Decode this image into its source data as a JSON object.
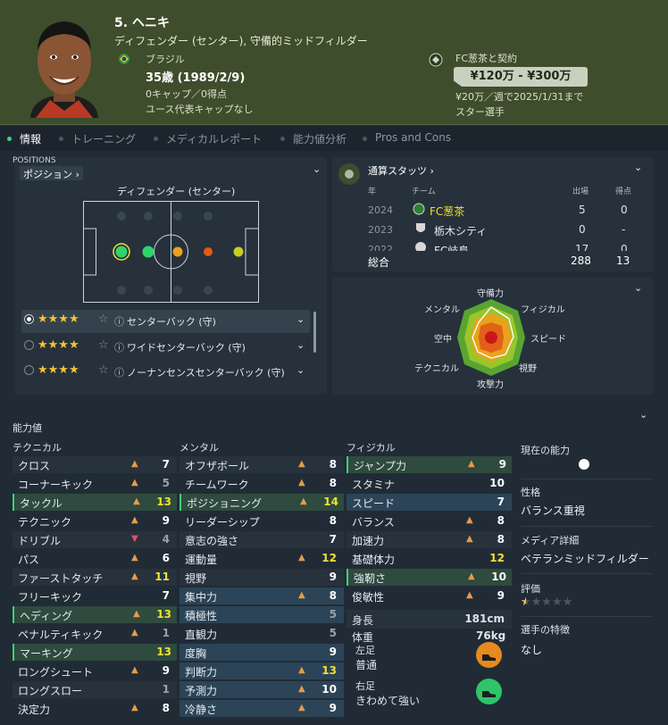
{
  "player": {
    "name": "5. ヘニキ",
    "position_desc": "ディフェンダー (センター), 守備的ミッドフィルダー",
    "nationality": "ブラジル",
    "age": "35歳 (1989/2/9)",
    "caps": "0キャップ／0得点",
    "youth_caps": "ユース代表キャップなし",
    "contract_club": "FC葱茶と契約",
    "value": "¥120万 - ¥300万",
    "wage": "¥20万／週で2025/1/31まで",
    "status": "スター選手"
  },
  "tabs": [
    {
      "label": "情報"
    },
    {
      "label": "トレーニング"
    },
    {
      "label": "メディカルレポート"
    },
    {
      "label": "能力値分析"
    },
    {
      "label": "Pros and Cons"
    }
  ],
  "positions": {
    "header": "ポジション",
    "overlay": "POSITIONS",
    "pitch_title": "ディフェンダー (センター)",
    "roles": [
      {
        "name": "センターバック (守)",
        "stars": "★★★★",
        "half_star": "☆"
      },
      {
        "name": "ワイドセンターバック (守)",
        "stars": "★★★★",
        "half_star": "☆"
      },
      {
        "name": "ノーナンセンスセンターバック (守)",
        "stars": "★★★★",
        "half_star": "☆"
      }
    ]
  },
  "career": {
    "header": "通算スタッツ",
    "col_year": "年",
    "col_team": "チーム",
    "col_apps": "出場",
    "col_goals": "得点",
    "rows": [
      {
        "year": "2024",
        "team": "FC葱茶",
        "apps": "5",
        "goals": "0"
      },
      {
        "year": "2023",
        "team": "栃木シティ",
        "apps": "0",
        "goals": "-"
      },
      {
        "year": "2022",
        "team": "FC岐阜",
        "apps": "17",
        "goals": "0"
      }
    ],
    "total_label": "総合",
    "total_apps": "288",
    "total_goals": "13"
  },
  "radar": {
    "labels": {
      "top": "守備力",
      "top_right": "フィジカル",
      "right": "スピード",
      "bottom_right": "視野",
      "bottom": "攻撃力",
      "bottom_left": "テクニカル",
      "left": "空中",
      "top_left": "メンタル"
    }
  },
  "attributes": {
    "section_label": "能力値",
    "technical_header": "テクニカル",
    "mental_header": "メンタル",
    "physical_header": "フィジカル",
    "technical": [
      {
        "name": "クロス",
        "value": "7",
        "arrow": "▲"
      },
      {
        "name": "コーナーキック",
        "value": "5",
        "arrow": "▲"
      },
      {
        "name": "タックル",
        "value": "13",
        "arrow": "▲"
      },
      {
        "name": "テクニック",
        "value": "9",
        "arrow": "▲"
      },
      {
        "name": "ドリブル",
        "value": "4",
        "arrow": "▼"
      },
      {
        "name": "パス",
        "value": "6",
        "arrow": "▲"
      },
      {
        "name": "ファーストタッチ",
        "value": "11",
        "arrow": "▲"
      },
      {
        "name": "フリーキック",
        "value": "7",
        "arrow": ""
      },
      {
        "name": "ヘディング",
        "value": "13",
        "arrow": "▲"
      },
      {
        "name": "ペナルティキック",
        "value": "1",
        "arrow": "▲"
      },
      {
        "name": "マーキング",
        "value": "13",
        "arrow": ""
      },
      {
        "name": "ロングシュート",
        "value": "9",
        "arrow": "▲"
      },
      {
        "name": "ロングスロー",
        "value": "1",
        "arrow": ""
      },
      {
        "name": "決定力",
        "value": "8",
        "arrow": "▲"
      }
    ],
    "mental": [
      {
        "name": "オフザボール",
        "value": "8",
        "arrow": "▲"
      },
      {
        "name": "チームワーク",
        "value": "8",
        "arrow": "▲"
      },
      {
        "name": "ポジショニング",
        "value": "14",
        "arrow": "▲"
      },
      {
        "name": "リーダーシップ",
        "value": "8",
        "arrow": ""
      },
      {
        "name": "意志の強さ",
        "value": "7",
        "arrow": ""
      },
      {
        "name": "運動量",
        "value": "12",
        "arrow": "▲"
      },
      {
        "name": "視野",
        "value": "9",
        "arrow": ""
      },
      {
        "name": "集中力",
        "value": "8",
        "arrow": "▲"
      },
      {
        "name": "積極性",
        "value": "5",
        "arrow": ""
      },
      {
        "name": "直観力",
        "value": "5",
        "arrow": ""
      },
      {
        "name": "度胸",
        "value": "9",
        "arrow": ""
      },
      {
        "name": "判断力",
        "value": "13",
        "arrow": "▲"
      },
      {
        "name": "予測力",
        "value": "10",
        "arrow": "▲"
      },
      {
        "name": "冷静さ",
        "value": "9",
        "arrow": "▲"
      }
    ],
    "physical": [
      {
        "name": "ジャンプ力",
        "value": "9",
        "arrow": "▲"
      },
      {
        "name": "スタミナ",
        "value": "10",
        "arrow": ""
      },
      {
        "name": "スピード",
        "value": "7",
        "arrow": ""
      },
      {
        "name": "バランス",
        "value": "8",
        "arrow": "▲"
      },
      {
        "name": "加速力",
        "value": "8",
        "arrow": "▲"
      },
      {
        "name": "基礎体力",
        "value": "12",
        "arrow": ""
      },
      {
        "name": "強靭さ",
        "value": "10",
        "arrow": "▲"
      },
      {
        "name": "俊敏性",
        "value": "9",
        "arrow": "▲"
      }
    ],
    "height_label": "身長",
    "height_value": "181cm",
    "weight_label": "体重",
    "weight_value": "76kg",
    "left_foot_label": "左足",
    "left_foot_value": "普通",
    "right_foot_label": "右足",
    "right_foot_value": "きわめて強い"
  },
  "side": {
    "current_ability_label": "現在の能力",
    "personality_label": "性格",
    "personality_value": "バランス重視",
    "media_label": "メディア詳細",
    "media_value": "ベテランミッドフィルダー",
    "rating_label": "評価",
    "rating_stars": "★★★★★",
    "traits_label": "選手の特徴",
    "traits_value": "なし"
  },
  "colors": {
    "header_bg": "#3e4d2c",
    "green_highlight": "#2f4a3f",
    "blue_highlight": "#2c4457",
    "yellow_value": "#f0e130",
    "arrow_orange": "#e89a4a"
  }
}
